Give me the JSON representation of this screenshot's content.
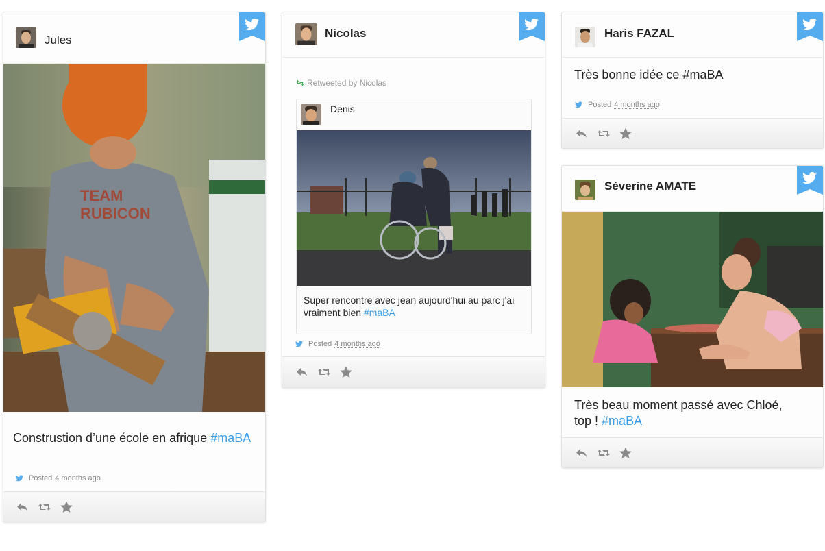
{
  "brand": {
    "twitter_color": "#55acee",
    "hashtag_color": "#3a9ee8"
  },
  "posts": [
    {
      "author": "Jules",
      "text": "Construstion d’une école en afrique",
      "hashtag": "#maBA",
      "posted_label": "Posted",
      "posted_time": "4 months ago",
      "image": "construction-worker-cutting-wood"
    },
    {
      "author": "Nicolas",
      "retweet_label": "Retweeted by Nicolas",
      "retweeted": {
        "author": "Denis",
        "text": "Super rencontre avec jean aujourd'hui au parc j'ai vraiment bien",
        "hashtag": "#maBA",
        "image": "wheelchair-park-scene"
      },
      "posted_label": "Posted",
      "posted_time": "4 months ago"
    },
    {
      "author": "Haris FAZAL",
      "text": "Très bonne idée ce #maBA",
      "posted_label": "Posted",
      "posted_time": "4 months ago"
    },
    {
      "author": "Séverine AMATE",
      "text_line1": "Très beau moment passé avec Chloé,",
      "text_line2": "top !",
      "hashtag": "#maBA",
      "image": "woman-and-child-at-table"
    }
  ],
  "actions": [
    "reply-icon",
    "retweet-icon",
    "favorite-icon"
  ]
}
